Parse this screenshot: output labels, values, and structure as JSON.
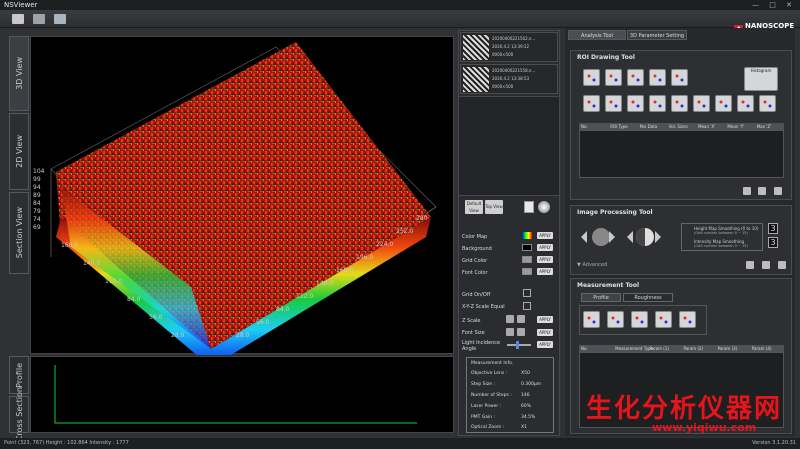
{
  "window": {
    "title": "NSViewer",
    "controls": "— □ ✕"
  },
  "toolbar": {
    "icons": [
      "folder-open-icon",
      "save-icon",
      "monitor-icon"
    ]
  },
  "logo": {
    "text": "NANOSCOPE",
    "sub": "SYSTEMS"
  },
  "left_tabs": {
    "view3d": "3D View",
    "view2d": "2D View",
    "section": "Section View",
    "profile": "Profile",
    "cross": "Cross Section"
  },
  "plot": {
    "z_ticks": [
      "104",
      "99",
      "94",
      "89",
      "84",
      "79",
      "74",
      "69"
    ],
    "y_ticks": [
      "168.0",
      "140.0",
      "112.0",
      "84.0",
      "56.0",
      "28.0"
    ],
    "x_ticks": [
      "280",
      "252.0",
      "224.0",
      "196.0",
      "168.0",
      "140.0",
      "112.0",
      "84.0",
      "56.0",
      "28.0"
    ],
    "front_ticks": [
      "210",
      "158.0",
      "167.0",
      "157.0",
      "147.0",
      "137.0"
    ]
  },
  "files": [
    {
      "name": "20200406221562.n...",
      "date": "2020.4.2 13:39:22",
      "zoom": "0000×500"
    },
    {
      "name": "20200406221558.n...",
      "date": "2020.4.2 13:38:53",
      "zoom": "0000×500"
    }
  ],
  "view_buttons": {
    "default": "Default View",
    "top": "Top View"
  },
  "settings": {
    "color_map": "Color Map",
    "background": "Background",
    "grid_color": "Grid Color",
    "font_color": "Font Color",
    "grid_onoff": "Grid On/Off",
    "xyz_equal": "X-Y-Z Scale Equal",
    "z_scale": "Z Scale",
    "font_size": "Font Size",
    "light_angle": "Light Incidence Angle",
    "apply": "APPLY",
    "colors": {
      "background": "#000000",
      "grid": "#9a9a9a",
      "font": "#9a9a9a"
    }
  },
  "measurement_info": {
    "title": "Measurement Info.",
    "rows": [
      {
        "label": "Objective Lens :",
        "value": "X50"
      },
      {
        "label": "Step Size :",
        "value": "0.300μm"
      },
      {
        "label": "Number of Steps :",
        "value": "146"
      },
      {
        "label": "Laser Power :",
        "value": "60%"
      },
      {
        "label": "PMT Gain :",
        "value": "34.5%"
      },
      {
        "label": "Optical Zoom :",
        "value": "X1"
      }
    ]
  },
  "right": {
    "tabs": [
      "Analysis Tool",
      "3D Parameter Setting"
    ],
    "roi": {
      "title": "ROI Drawing Tool",
      "histogram": "Histogram",
      "columns": [
        "No.",
        "ROI Type",
        "Pos Data",
        "Vol. Sizes",
        "Mean 'X'",
        "Mean 'Y'",
        "Max 'Z'"
      ]
    },
    "image_proc": {
      "title": "Image Processing Tool",
      "height_smooth": "Height Map Smoothing (0 to 10)",
      "height_sub": "(Odd number between 0 ~ 15)",
      "intensity_smooth": "Intensity Map Smoothing",
      "intensity_sub": "(Odd number between 0 ~ 15)",
      "value1": "3",
      "value2": "3",
      "advanced": "Advanced"
    },
    "measure": {
      "title": "Measurement Tool",
      "tabs": [
        "Profile",
        "Roughness"
      ],
      "columns": [
        "No.",
        "Measurement Type",
        "Param (1)",
        "Param (2)",
        "Param (3)",
        "Param (4)"
      ]
    }
  },
  "status": {
    "text": "Point (323, 767) Height : 102.864 Intensity : 1777",
    "version": "Version 3.1.20.31"
  },
  "watermark": {
    "cn": "生化分析仪器网",
    "url": "www.yiqiwu.com"
  }
}
